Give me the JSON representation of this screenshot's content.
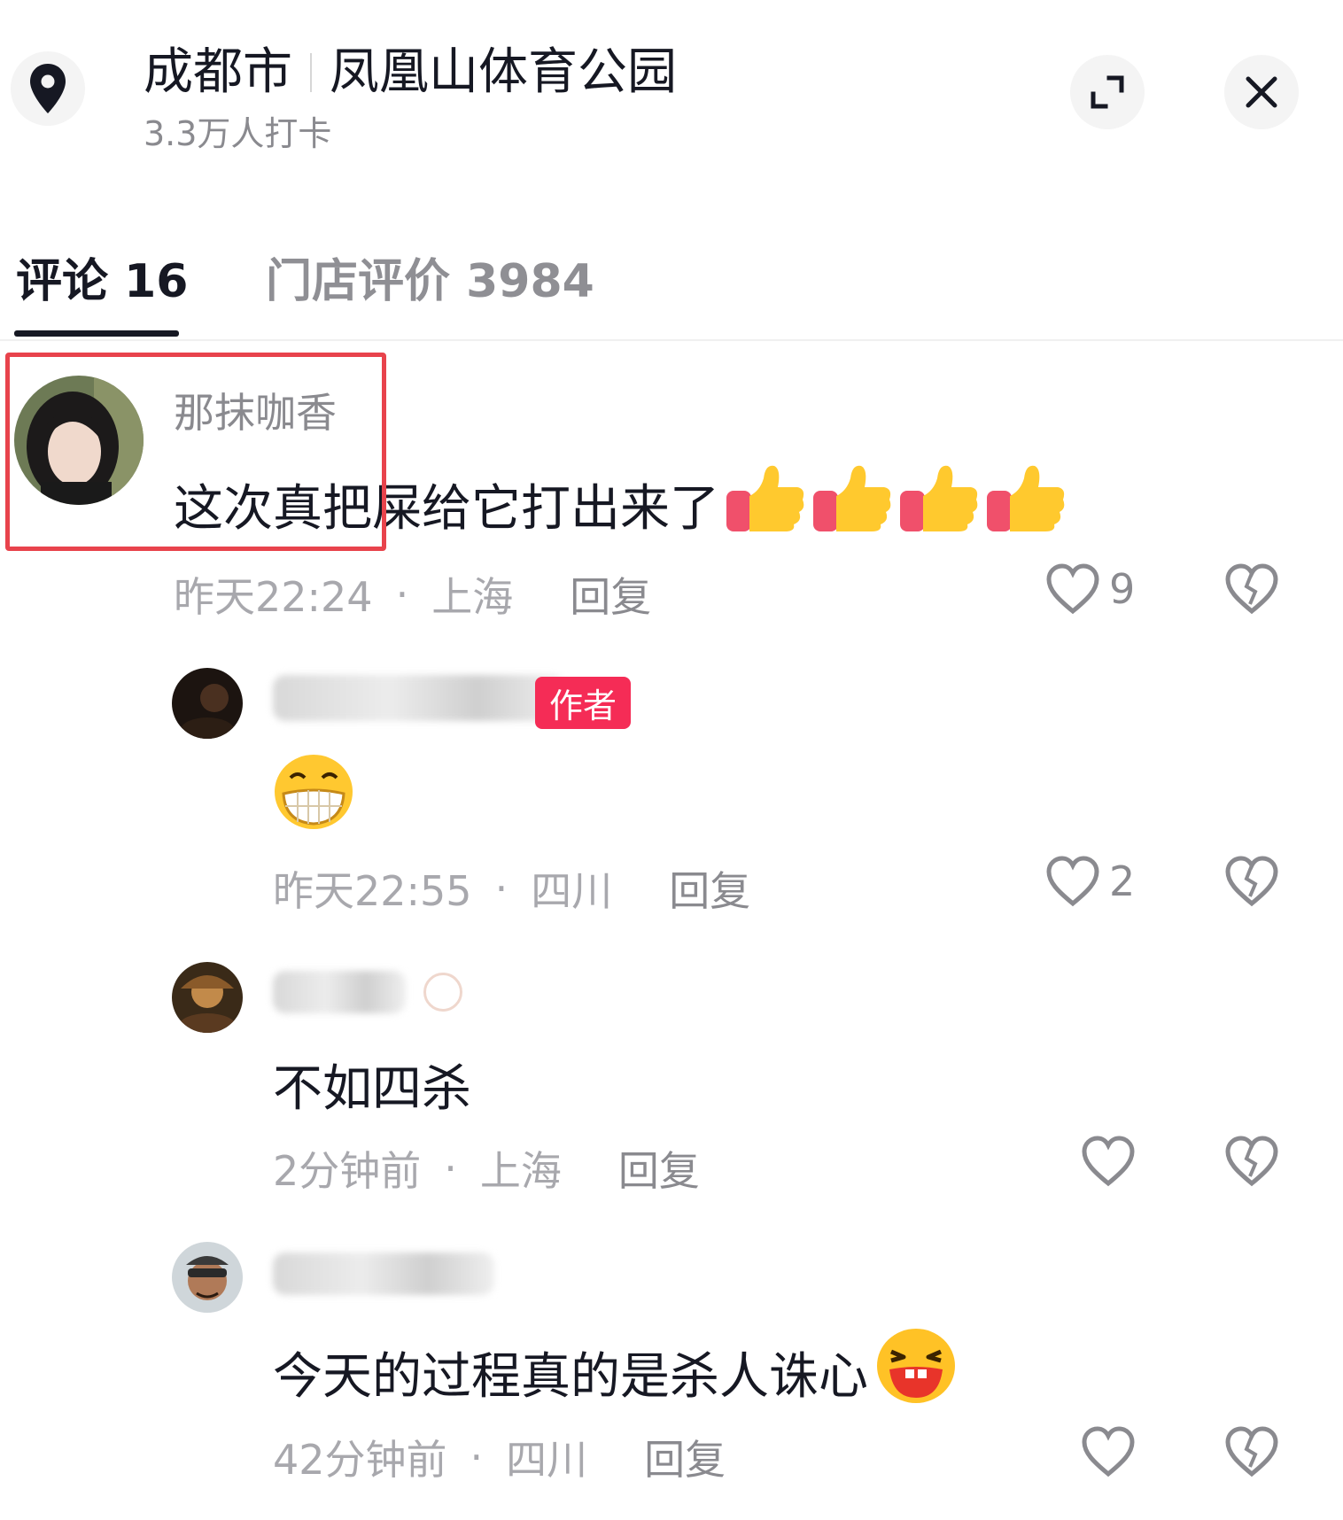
{
  "header": {
    "city": "成都市",
    "place": "凤凰山体育公园",
    "checkins": "3.3万人打卡"
  },
  "tabs": [
    {
      "label": "评论 16",
      "active": true
    },
    {
      "label": "门店评价 3984",
      "active": false
    }
  ],
  "comments": [
    {
      "username": "那抹咖香",
      "text": "这次真把屎给它打出来了",
      "emoji": [
        "thumbs-up",
        "thumbs-up",
        "thumbs-up",
        "thumbs-up"
      ],
      "time": "昨天22:24",
      "location": "上海",
      "reply_label": "回复",
      "likes": "9",
      "highlighted": true
    },
    {
      "username_blurred": true,
      "badge": "作者",
      "emoji": [
        "grin"
      ],
      "time": "昨天22:55",
      "location": "四川",
      "reply_label": "回复",
      "likes": "2"
    },
    {
      "username_blurred": true,
      "text": "不如四杀",
      "time": "2分钟前",
      "location": "上海",
      "reply_label": "回复",
      "likes": ""
    },
    {
      "username_blurred": true,
      "text": "今天的过程真的是杀人诛心",
      "emoji": [
        "laugh"
      ],
      "time": "42分钟前",
      "location": "四川",
      "reply_label": "回复",
      "likes": ""
    }
  ],
  "meta_separator": "·",
  "colors": {
    "accent": "#f52c56",
    "highlight": "#e8434c",
    "text": "#161823",
    "muted": "#8a8a8f"
  },
  "icons": [
    "location-pin-icon",
    "expand-icon",
    "close-icon",
    "heart-icon",
    "broken-heart-icon"
  ]
}
